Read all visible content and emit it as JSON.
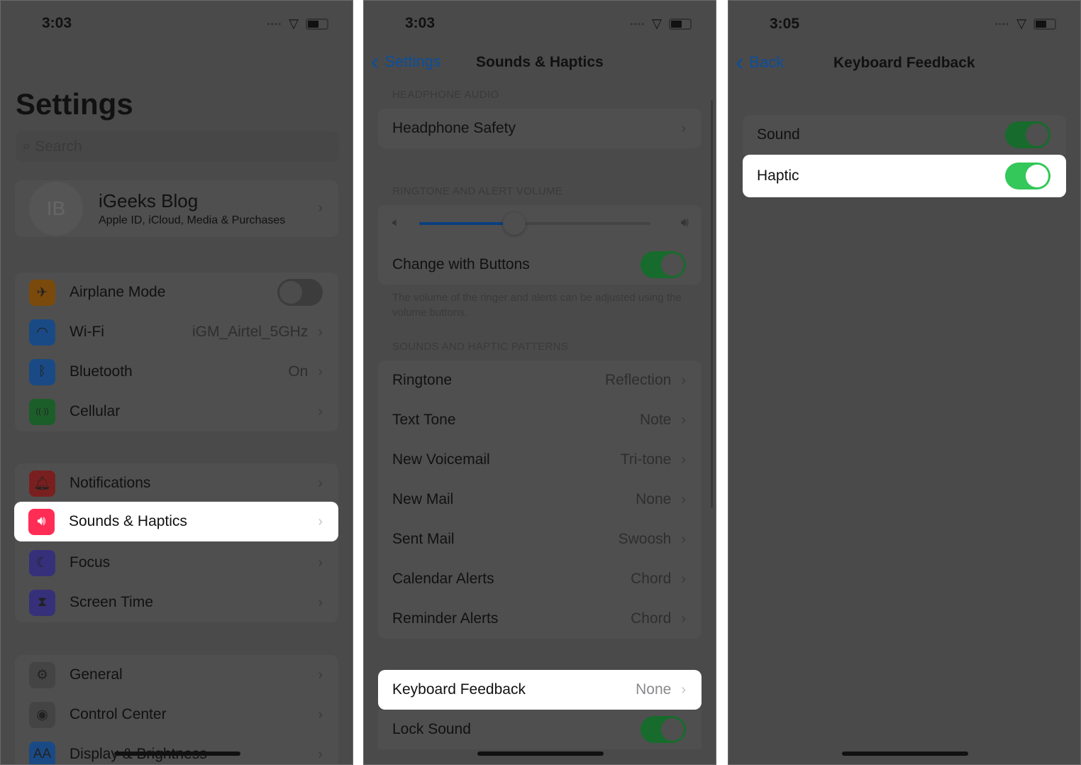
{
  "colors": {
    "accent": "#0a4f9e",
    "toggle_on": "#34c759",
    "highlight": "#ffffff"
  },
  "panel1": {
    "time": "3:03",
    "title": "Settings",
    "search_placeholder": "Search",
    "profile": {
      "initials": "IB",
      "name": "iGeeks Blog",
      "subtitle": "Apple ID, iCloud, Media & Purchases"
    },
    "groups": [
      [
        {
          "label": "Airplane Mode",
          "icon": "airplane-icon",
          "toggle": false
        },
        {
          "label": "Wi-Fi",
          "icon": "wifi-icon",
          "value": "iGM_Airtel_5GHz"
        },
        {
          "label": "Bluetooth",
          "icon": "bluetooth-icon",
          "value": "On"
        },
        {
          "label": "Cellular",
          "icon": "cellular-icon"
        }
      ],
      [
        {
          "label": "Notifications",
          "icon": "bell-icon"
        },
        {
          "label": "Sounds & Haptics",
          "icon": "speaker-icon",
          "highlighted": true
        },
        {
          "label": "Focus",
          "icon": "moon-icon"
        },
        {
          "label": "Screen Time",
          "icon": "hourglass-icon"
        }
      ],
      [
        {
          "label": "General",
          "icon": "gear-icon"
        },
        {
          "label": "Control Center",
          "icon": "switches-icon"
        },
        {
          "label": "Display & Brightness",
          "icon": "text-size-icon"
        }
      ]
    ]
  },
  "panel2": {
    "time": "3:03",
    "back": "Settings",
    "title": "Sounds & Haptics",
    "headphone_header": "HEADPHONE AUDIO",
    "headphone_safety": "Headphone Safety",
    "volume_header": "RINGTONE AND ALERT VOLUME",
    "volume_level": 0.41,
    "change_with_buttons": "Change with Buttons",
    "change_with_buttons_on": true,
    "volume_note": "The volume of the ringer and alerts can be adjusted using the volume buttons.",
    "patterns_header": "SOUNDS AND HAPTIC PATTERNS",
    "patterns": [
      {
        "label": "Ringtone",
        "value": "Reflection"
      },
      {
        "label": "Text Tone",
        "value": "Note"
      },
      {
        "label": "New Voicemail",
        "value": "Tri-tone"
      },
      {
        "label": "New Mail",
        "value": "None"
      },
      {
        "label": "Sent Mail",
        "value": "Swoosh"
      },
      {
        "label": "Calendar Alerts",
        "value": "Chord"
      },
      {
        "label": "Reminder Alerts",
        "value": "Chord"
      }
    ],
    "keyboard_feedback": {
      "label": "Keyboard Feedback",
      "value": "None"
    },
    "lock_sound": "Lock Sound",
    "lock_sound_on": true
  },
  "panel3": {
    "time": "3:05",
    "back": "Back",
    "title": "Keyboard Feedback",
    "sound": "Sound",
    "sound_on": true,
    "haptic": "Haptic",
    "haptic_on": true
  }
}
